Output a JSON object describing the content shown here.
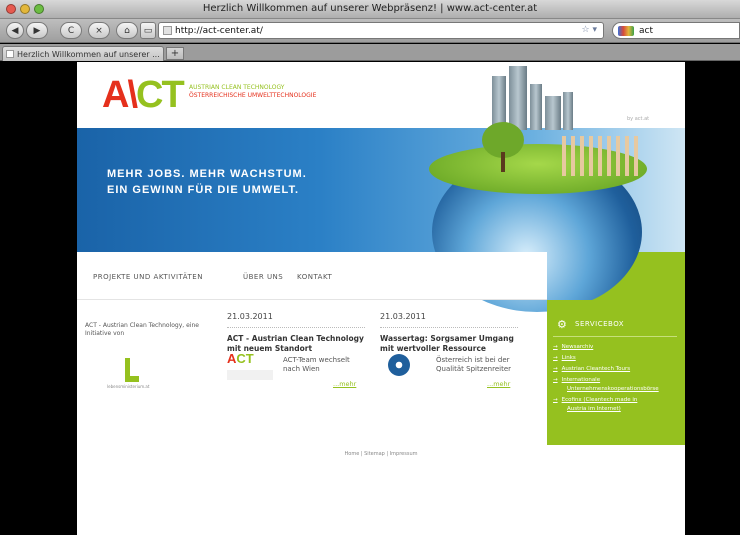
{
  "browser": {
    "window_title": "Herzlich Willkommen auf unserer Webpräsenz! | www.act-center.at",
    "url": "http://act-center.at/",
    "search_query": "act",
    "tab_title": "Herzlich Willkommen auf unserer ...",
    "new_tab_label": "+",
    "back_label": "◀",
    "forward_label": "▶",
    "reload_label": "C",
    "home_label": "⌂"
  },
  "site": {
    "logo_ac": "A\\",
    "logo_ct": "CT",
    "tagline_1": "AUSTRIAN CLEAN TECHNOLOGY",
    "tagline_2": "ÖSTERREICHISCHE UMWELTTECHNOLOGIE",
    "corner_text": "by act.at",
    "hero_line_1": "MEHR JOBS. MEHR WACHSTUM.",
    "hero_line_2": "EIN GEWINN FÜR DIE UMWELT.",
    "nav": [
      "PROJEKTE UND AKTIVITÄTEN",
      "ÜBER UNS",
      "KONTAKT"
    ],
    "intro_text": "ACT - Austrian Clean Technology, eine Initiative von",
    "intro_logo_caption": "lebensministerium.at",
    "news": [
      {
        "date": "21.03.2011",
        "title": "ACT - Austrian Clean Technology mit neuem Standort",
        "body": "ACT-Team wechselt nach Wien",
        "more": "...mehr"
      },
      {
        "date": "21.03.2011",
        "title": "Wassertag: Sorgsamer Umgang mit wertvoller Ressource",
        "body": "Österreich ist bei der Qualität Spitzenreiter",
        "more": "...mehr"
      }
    ],
    "servicebox": {
      "title": "SERVICEBOX",
      "links": [
        "Newsarchiv",
        "Links",
        "Austrian Cleantech Tours",
        "Internationale",
        "Unternehmenskooperationsbörse",
        "Ecofinx (Cleantech made in",
        "Austria im Internet)"
      ]
    },
    "footer": "Home | Sitemap | Impressum"
  },
  "colors": {
    "brand_red": "#e5301c",
    "brand_green": "#95c11f",
    "hero_blue": "#2b80c6"
  }
}
